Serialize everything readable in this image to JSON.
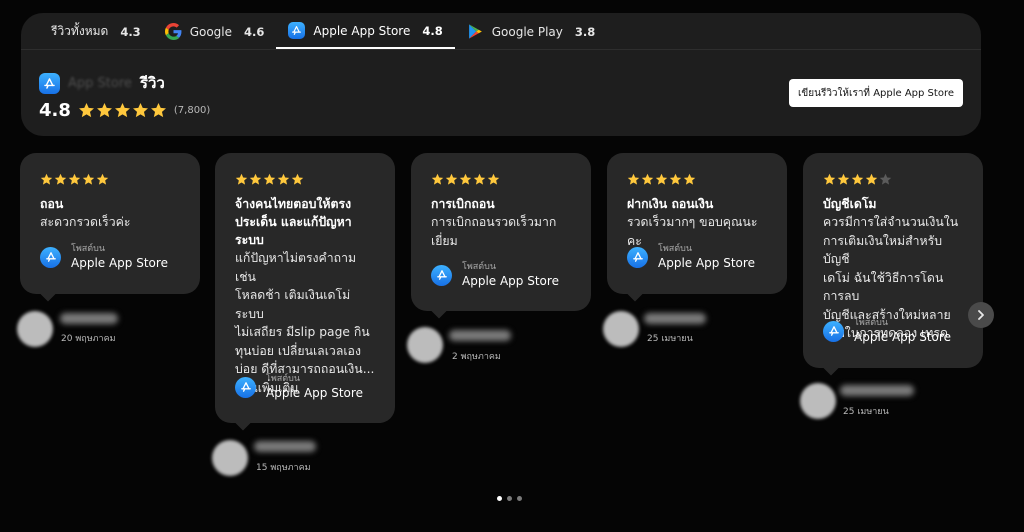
{
  "tabs": [
    {
      "label": "รีวิวทั้งหมด",
      "score": "4.3",
      "icon": "none"
    },
    {
      "label": "Google",
      "score": "4.6",
      "icon": "google-icon"
    },
    {
      "label": "Apple App Store",
      "score": "4.8",
      "icon": "app-store-icon",
      "active": true
    },
    {
      "label": "Google Play",
      "score": "3.8",
      "icon": "google-play-icon"
    }
  ],
  "summary": {
    "store_name": "App Store",
    "title": "รีวิว",
    "rating": "4.8",
    "stars": 5,
    "count": "(7,800)",
    "write_button": "เขียนรีวิวให้เราที่ Apple App Store"
  },
  "reviews": [
    {
      "stars": 5,
      "title": "ถอน",
      "body_lines": [
        "สะดวกรวดเร็วค่ะ"
      ],
      "posted_on": "โพสต์บน",
      "store": "Apple App Store",
      "date": "20 พฤษภาคม"
    },
    {
      "stars": 5,
      "title_lines": [
        "จ้างคนไทยตอบให้ตรง",
        "ประเด็น และแก้ปัญหา",
        "ระบบ"
      ],
      "body_lines": [
        "แก้ปัญหาไม่ตรงคำถาม เช่น",
        "โหลดช้า เติมเงินเดโม่ ระบบ",
        "ไม่เสถียร มีslip page กิน",
        "ทุนบ่อย เปลี่ยนเลเวลเอง",
        "บ่อย ดีที่สามารถถอนเงิน...",
        "อ่านเพิ่มเติม"
      ],
      "posted_on": "โพสต์บน",
      "store": "Apple App Store",
      "date": "15 พฤษภาคม"
    },
    {
      "stars": 5,
      "title": "การเบิกถอน",
      "body_lines": [
        "การเบิกถอนรวดเร็วมาก",
        "เยี่ยม"
      ],
      "posted_on": "โพสต์บน",
      "store": "Apple App Store",
      "date": "2 พฤษภาคม"
    },
    {
      "stars": 5,
      "title": "ฝากเงิน ถอนเงิน",
      "body_lines": [
        "รวดเร็วมากๆ ขอบคุณนะคะ"
      ],
      "posted_on": "โพสต์บน",
      "store": "Apple App Store",
      "date": "25 เมษายน"
    },
    {
      "stars": 4,
      "title": "บัญชีเดโม",
      "body_lines": [
        "ควรมีการใส่จำนวนเงินใน",
        "การเติมเงินใหม่สำหรับบัญชี",
        "เดโม่ ฉันใช้วิธีการโดนการลบ",
        "บัญชีและสร้างใหม่หลาย",
        "รอบในการทดลอง เทรด"
      ],
      "posted_on": "โพสต์บน",
      "store": "Apple App Store",
      "date": "25 เมษายน"
    }
  ],
  "colors": {
    "star": "#ffc83d",
    "star_empty": "#5b5b5b",
    "card": "#282828",
    "panel": "#1e1e1e",
    "accent_blue": "#1f8bff"
  },
  "pagination": {
    "pages": 3,
    "current": 1
  }
}
